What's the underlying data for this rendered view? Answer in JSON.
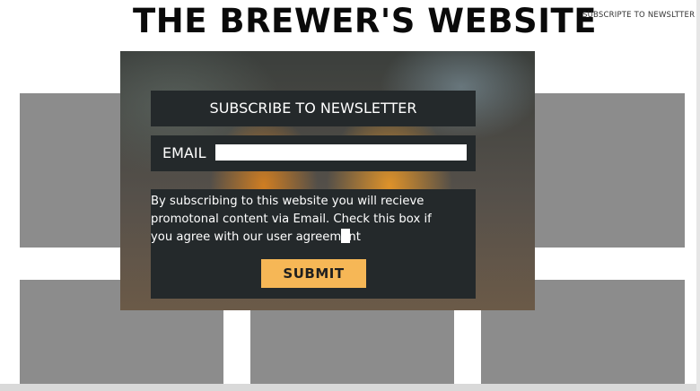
{
  "header": {
    "site_title": "THE BREWER'S WEBSITE",
    "subscribe_link": "SUBSCRIPTE TO NEWSLTTER"
  },
  "modal": {
    "title": "SUBSCRIBE TO NEWSLETTER",
    "email_label": "EMAIL",
    "email_value": "",
    "agreement_text": "By subscribing to this website you will recieve promotonal content via Email. Check this box if you agree with our user agreement",
    "agreement_checked": false,
    "submit_label": "SUBMIT"
  },
  "colors": {
    "modal_panel": "#24292b",
    "submit_button": "#f6b756",
    "placeholder_tile": "#8c8c8c"
  }
}
